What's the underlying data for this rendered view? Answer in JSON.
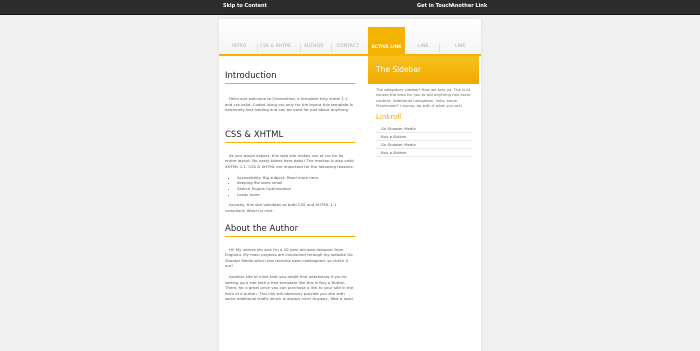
{
  "topbar": {
    "skip": "Skip to Content",
    "right": [
      "Get in Touch",
      "Another Link"
    ]
  },
  "nav": {
    "items": [
      "INTRO",
      "CSS & XHTML",
      "AUTHOR",
      "CONTACT"
    ],
    "active": "ACTIVE LINK",
    "right": [
      "LINK",
      "LINK"
    ]
  },
  "sidebar": {
    "title": "The Sidebar",
    "text": "The obligatory sidebar! How we love ya. The is of course the area for you to put anything non-main-content. Additional navigation, links, some Flashmode? I dunno, do with it what you will!",
    "linkroll_title": "Linkroll",
    "links": [
      "Go Shooter Media",
      "Buy a Button",
      "Go Shooter Media",
      "Buy a Button"
    ]
  },
  "main": {
    "intro_title": "Introduction",
    "intro_text": "Hello and welcome to Clementine, a template fully xhtml 1.1 and css valid. Coded using css only for the layout this template is extremely fast loading and can be used for just about anything.",
    "css_title": "CSS & XHTML",
    "css_text1": "As you would expect, this web site makes use of css for its entire layout. No nasty tables here baby! The markup is also valid XHTML 1.1. CSS & XHTML are important for the following reasons:",
    "css_list": [
      "Accessibility. Big subject. Read more here.",
      "Keeping file sizes small",
      "Search Engine Optimisation",
      "Loads more"
    ],
    "css_text2": "Anyway, this site validates as both CSS and XHTML 1.1 compliant. Which is nice.",
    "author_title": "About the Author",
    "author_text1": "Hi! My names Jan and I'm a 20 year old web designer from England. My main projects are conducted through my website Go Shooter Media which has recently been redesigned, so check it out!",
    "author_text2": "Another site of mine that you might find interesting if you're setting up a site with a free template like this is Buy a Button. There, for a great price you can purchase a link to your site in the form of a button. This link will obviously provide you site with some additional traffic which is always nice! Anyway, Take a look!"
  }
}
